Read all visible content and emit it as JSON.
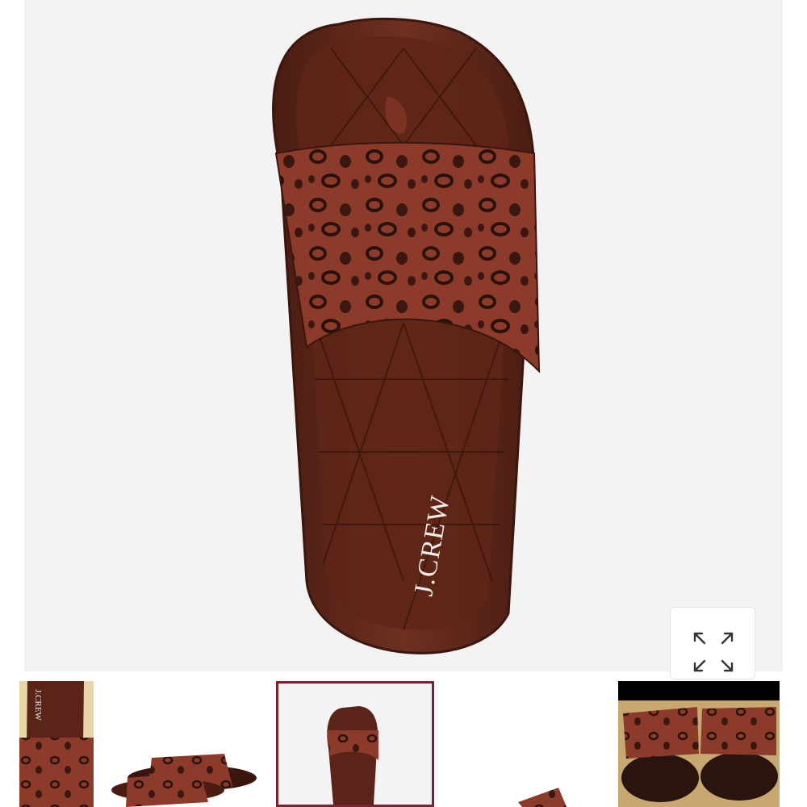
{
  "product": {
    "brand_on_insole": "J.CREW"
  },
  "viewer": {
    "expand_icon": "expand-arrows-icon",
    "background_color": "#f3f3f3"
  },
  "thumbnails": [
    {
      "label": "",
      "selected": false
    },
    {
      "label": "",
      "selected": false
    },
    {
      "label": "",
      "selected": true
    },
    {
      "label": "",
      "selected": false
    },
    {
      "label": "",
      "selected": false
    }
  ],
  "colors": {
    "selected_border": "#7a2330",
    "sole": "#5a2418",
    "strap": "#8a3a28"
  }
}
